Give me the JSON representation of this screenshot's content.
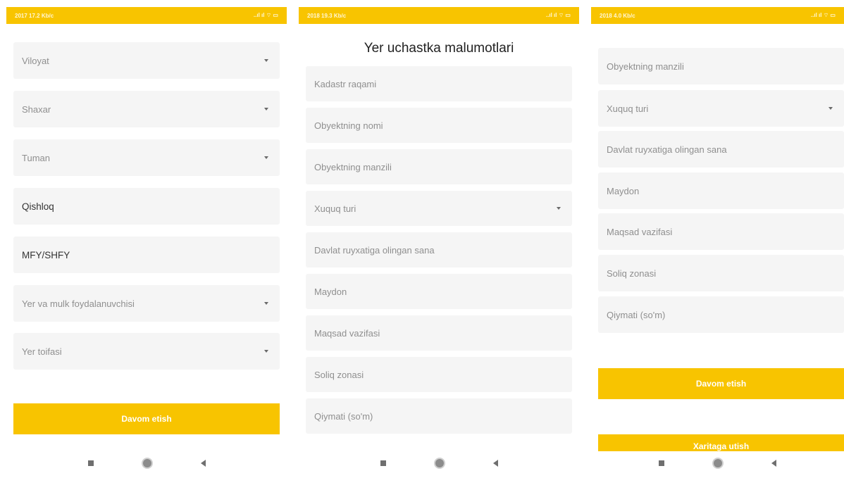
{
  "colors": {
    "accent": "#f8c400",
    "field_bg": "#f5f5f5"
  },
  "screen1": {
    "status_time": "2017 17.2 Kb/c",
    "status_icons": "..ıl ıl ⌔ ▭",
    "fields": [
      {
        "label": "Viloyat",
        "dropdown": true
      },
      {
        "label": "Shaxar",
        "dropdown": true
      },
      {
        "label": "Tuman",
        "dropdown": true
      },
      {
        "label": "Qishloq",
        "dropdown": false
      },
      {
        "label": "MFY/SHFY",
        "dropdown": false
      },
      {
        "label": "Yer va mulk foydalanuvchisi",
        "dropdown": true
      },
      {
        "label": "Yer toifasi",
        "dropdown": true
      }
    ],
    "button": "Davom etish"
  },
  "screen2": {
    "status_time": "2018 19.3 Kb/c",
    "status_icons": "..ıl ıl ⌔ ▭",
    "title": "Yer uchastka malumotlari",
    "fields": [
      {
        "label": "Kadastr raqami",
        "dropdown": false
      },
      {
        "label": "Obyektning nomi",
        "dropdown": false
      },
      {
        "label": "Obyektning manzili",
        "dropdown": false
      },
      {
        "label": "Xuquq turi",
        "dropdown": true
      },
      {
        "label": "Davlat ruyxatiga olingan sana",
        "dropdown": false
      },
      {
        "label": "Maydon",
        "dropdown": false
      },
      {
        "label": "Maqsad vazifasi",
        "dropdown": false
      },
      {
        "label": "Soliq zonasi",
        "dropdown": false
      },
      {
        "label": "Qiymati (so'm)",
        "dropdown": false
      }
    ]
  },
  "screen3": {
    "status_time": "2018 4.0 Kb/c",
    "status_icons": "..ıl ıl ⌔ ▭",
    "fields": [
      {
        "label": "Obyektning manzili",
        "dropdown": false
      },
      {
        "label": "Xuquq turi",
        "dropdown": true
      },
      {
        "label": "Davlat ruyxatiga olingan sana",
        "dropdown": false
      },
      {
        "label": "Maydon",
        "dropdown": false
      },
      {
        "label": "Maqsad vazifasi",
        "dropdown": false
      },
      {
        "label": "Soliq zonasi",
        "dropdown": false
      },
      {
        "label": "Qiymati (so'm)",
        "dropdown": false
      }
    ],
    "button": "Davom etish",
    "button2": "Xaritaga utish"
  }
}
